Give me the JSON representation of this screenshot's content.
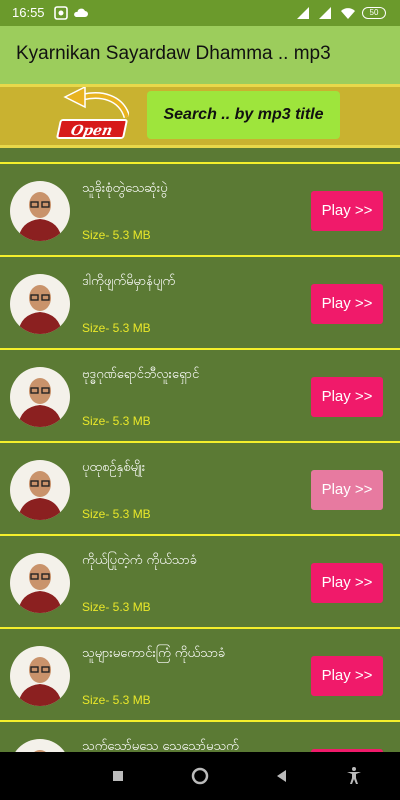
{
  "status": {
    "time": "16:55",
    "battery": "50"
  },
  "appbar": {
    "title": "Kyarnikan Sayardaw Dhamma .. mp3"
  },
  "toolbar": {
    "open_label": "Open",
    "search_label": "Search .. by mp3 title"
  },
  "items": [
    {
      "title": "သူခိုးစုံတွဲသေဆုံးပွဲ",
      "size": "Size- 5.3 MB",
      "play": "Play >>"
    },
    {
      "title": "ဒါကိုဖျက်မိမှာနံပျက်",
      "size": "Size- 5.3 MB",
      "play": "Play >>"
    },
    {
      "title": "ဗုဒ္ဓဂုဏ်ရောင်ဘီလူးရှောင်",
      "size": "Size- 5.3 MB",
      "play": "Play >>"
    },
    {
      "title": "ပုထုစဉ်နှစ်မျိုး",
      "size": "Size- 5.3 MB",
      "play": "Play >>"
    },
    {
      "title": "ကိုယ်ပြုတဲ့ကံ ကိုယ်သာခံ",
      "size": "Size- 5.3 MB",
      "play": "Play >>"
    },
    {
      "title": "သူများမကောင်းကြံ ကိုယ်သာခံ",
      "size": "Size- 5.3 MB",
      "play": "Play >>"
    },
    {
      "title": "သက်သော်မသေ သေသော်မသက်",
      "size": "",
      "play": ""
    }
  ],
  "colors": {
    "appbar": "#9ccd5c",
    "row_bg": "#5b7a34",
    "separator": "#f4ef2c",
    "play_button": "#f01a6a",
    "search_button": "#9ee53c"
  },
  "icons": {
    "nav": [
      "recent-apps-icon",
      "home-icon",
      "back-icon",
      "accessibility-icon"
    ]
  }
}
